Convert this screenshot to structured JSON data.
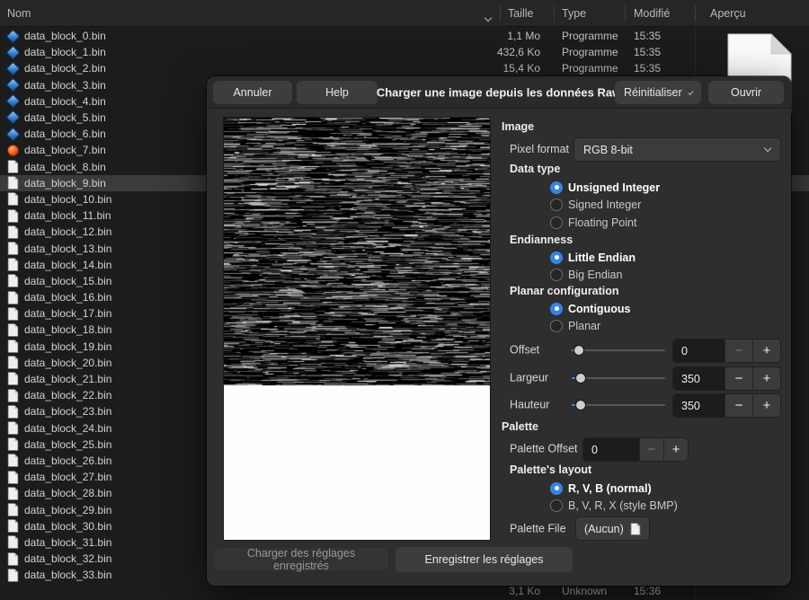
{
  "colors": {
    "accent": "#3584e4"
  },
  "file_manager": {
    "header": {
      "name": "Nom",
      "size": "Taille",
      "type": "Type",
      "modified": "Modifié",
      "preview": "Aperçu"
    },
    "rows": [
      {
        "name": "data_block_0.bin",
        "icon": "blue-diamond",
        "size": "1,1 Mo",
        "type": "Programme",
        "modified": "15:35"
      },
      {
        "name": "data_block_1.bin",
        "icon": "blue-diamond",
        "size": "432,6 Ko",
        "type": "Programme",
        "modified": "15:35"
      },
      {
        "name": "data_block_2.bin",
        "icon": "blue-diamond",
        "size": "15,4 Ko",
        "type": "Programme",
        "modified": "15:35"
      },
      {
        "name": "data_block_3.bin",
        "icon": "blue-diamond"
      },
      {
        "name": "data_block_4.bin",
        "icon": "blue-diamond"
      },
      {
        "name": "data_block_5.bin",
        "icon": "blue-diamond"
      },
      {
        "name": "data_block_6.bin",
        "icon": "blue-diamond"
      },
      {
        "name": "data_block_7.bin",
        "icon": "orange-disc"
      },
      {
        "name": "data_block_8.bin",
        "icon": "document"
      },
      {
        "name": "data_block_9.bin",
        "icon": "document",
        "selected": true
      },
      {
        "name": "data_block_10.bin",
        "icon": "document"
      },
      {
        "name": "data_block_11.bin",
        "icon": "document"
      },
      {
        "name": "data_block_12.bin",
        "icon": "document"
      },
      {
        "name": "data_block_13.bin",
        "icon": "document"
      },
      {
        "name": "data_block_14.bin",
        "icon": "document"
      },
      {
        "name": "data_block_15.bin",
        "icon": "document"
      },
      {
        "name": "data_block_16.bin",
        "icon": "document"
      },
      {
        "name": "data_block_17.bin",
        "icon": "document"
      },
      {
        "name": "data_block_18.bin",
        "icon": "document"
      },
      {
        "name": "data_block_19.bin",
        "icon": "document"
      },
      {
        "name": "data_block_20.bin",
        "icon": "document"
      },
      {
        "name": "data_block_21.bin",
        "icon": "document"
      },
      {
        "name": "data_block_22.bin",
        "icon": "document"
      },
      {
        "name": "data_block_23.bin",
        "icon": "document"
      },
      {
        "name": "data_block_24.bin",
        "icon": "document"
      },
      {
        "name": "data_block_25.bin",
        "icon": "document"
      },
      {
        "name": "data_block_26.bin",
        "icon": "document"
      },
      {
        "name": "data_block_27.bin",
        "icon": "document"
      },
      {
        "name": "data_block_28.bin",
        "icon": "document"
      },
      {
        "name": "data_block_29.bin",
        "icon": "document"
      },
      {
        "name": "data_block_30.bin",
        "icon": "document"
      },
      {
        "name": "data_block_31.bin",
        "icon": "document"
      },
      {
        "name": "data_block_32.bin",
        "icon": "document"
      },
      {
        "name": "data_block_33.bin",
        "icon": "document"
      },
      {
        "name": "",
        "icon": "",
        "size": "3,1 Ko",
        "type": "Unknown",
        "modified": "15:36"
      }
    ]
  },
  "dialog": {
    "title": "Charger une image depuis les données Raw",
    "header": {
      "cancel": "Annuler",
      "help": "Help",
      "reset": "Réinitialiser",
      "open": "Ouvrir"
    },
    "image_section": {
      "title": "Image",
      "pixel_format_label": "Pixel format",
      "pixel_format_value": "RGB 8-bit",
      "data_type_label": "Data type",
      "data_type_options": [
        {
          "label": "Unsigned Integer",
          "selected": true
        },
        {
          "label": "Signed Integer",
          "selected": false
        },
        {
          "label": "Floating Point",
          "selected": false
        }
      ],
      "endianness_label": "Endianness",
      "endianness_options": [
        {
          "label": "Little Endian",
          "selected": true
        },
        {
          "label": "Big Endian",
          "selected": false
        }
      ],
      "planar_label": "Planar configuration",
      "planar_options": [
        {
          "label": "Contiguous",
          "selected": true
        },
        {
          "label": "Planar",
          "selected": false
        }
      ],
      "offset_label": "Offset",
      "offset_value": "0",
      "width_label": "Largeur",
      "width_value": "350",
      "height_label": "Hauteur",
      "height_value": "350"
    },
    "palette_section": {
      "title": "Palette",
      "offset_label": "Palette Offset",
      "offset_value": "0",
      "layout_label": "Palette's layout",
      "layout_options": [
        {
          "label": "R, V, B (normal)",
          "selected": true
        },
        {
          "label": "B, V, R, X (style BMP)",
          "selected": false
        }
      ],
      "file_label": "Palette File",
      "file_value": "(Aucun)"
    },
    "footer": {
      "load_settings": "Charger des réglages enregistrés",
      "save_settings": "Enregistrer les réglages"
    }
  }
}
